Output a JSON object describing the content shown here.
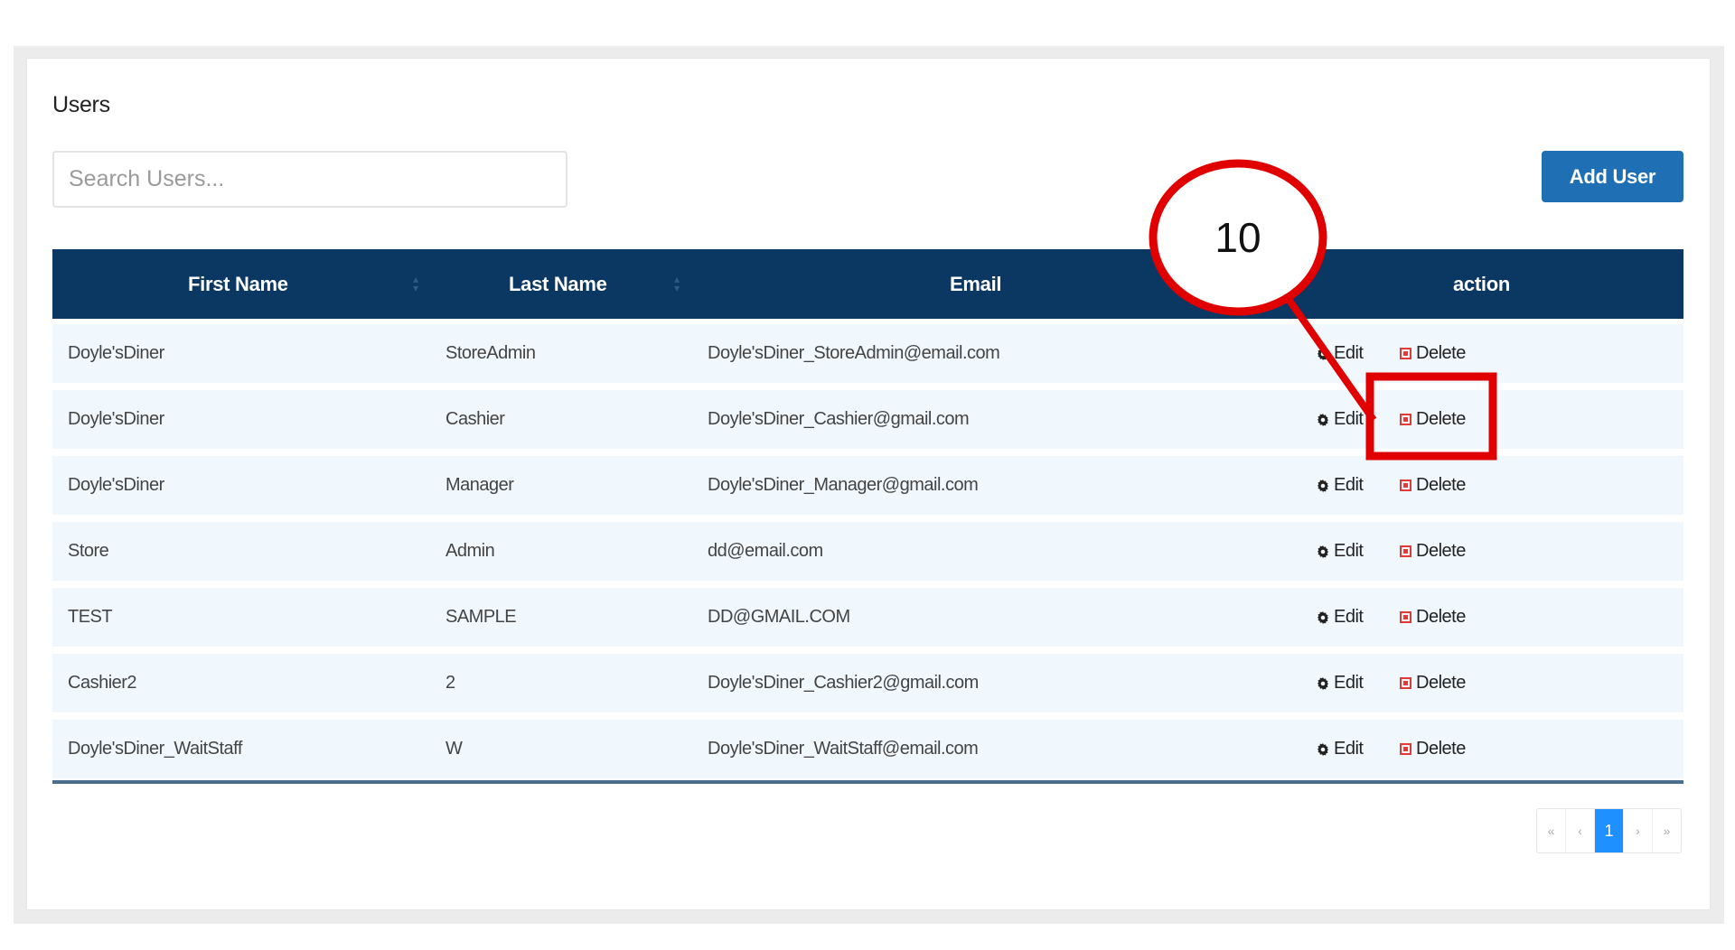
{
  "page_title": "Users",
  "search": {
    "placeholder": "Search Users..."
  },
  "add_user_label": "Add User",
  "table": {
    "headers": {
      "first_name": "First Name",
      "last_name": "Last Name",
      "email": "Email",
      "action": "action"
    },
    "edit_label": "Edit",
    "delete_label": "Delete",
    "rows": [
      {
        "first": "Doyle'sDiner",
        "last": "StoreAdmin",
        "email": "Doyle'sDiner_StoreAdmin@email.com"
      },
      {
        "first": "Doyle'sDiner",
        "last": "Cashier",
        "email": "Doyle'sDiner_Cashier@gmail.com"
      },
      {
        "first": "Doyle'sDiner",
        "last": "Manager",
        "email": "Doyle'sDiner_Manager@gmail.com"
      },
      {
        "first": "Store",
        "last": "Admin",
        "email": "dd@email.com"
      },
      {
        "first": "TEST",
        "last": "SAMPLE",
        "email": "DD@GMAIL.COM"
      },
      {
        "first": "Cashier2",
        "last": "2",
        "email": "Doyle'sDiner_Cashier2@gmail.com"
      },
      {
        "first": "Doyle'sDiner_WaitStaff",
        "last": "W",
        "email": "Doyle'sDiner_WaitStaff@email.com"
      }
    ]
  },
  "pagination": {
    "first": "«",
    "prev": "‹",
    "current": "1",
    "next": "›",
    "last": "»"
  },
  "annotation": {
    "number": "10",
    "color": "#e00000"
  },
  "colors": {
    "header_bg": "#0b3763",
    "row_bg": "#f0f7fd",
    "add_button": "#1f6fb4",
    "delete_icon": "#e53935",
    "page_active": "#1e90ff"
  }
}
